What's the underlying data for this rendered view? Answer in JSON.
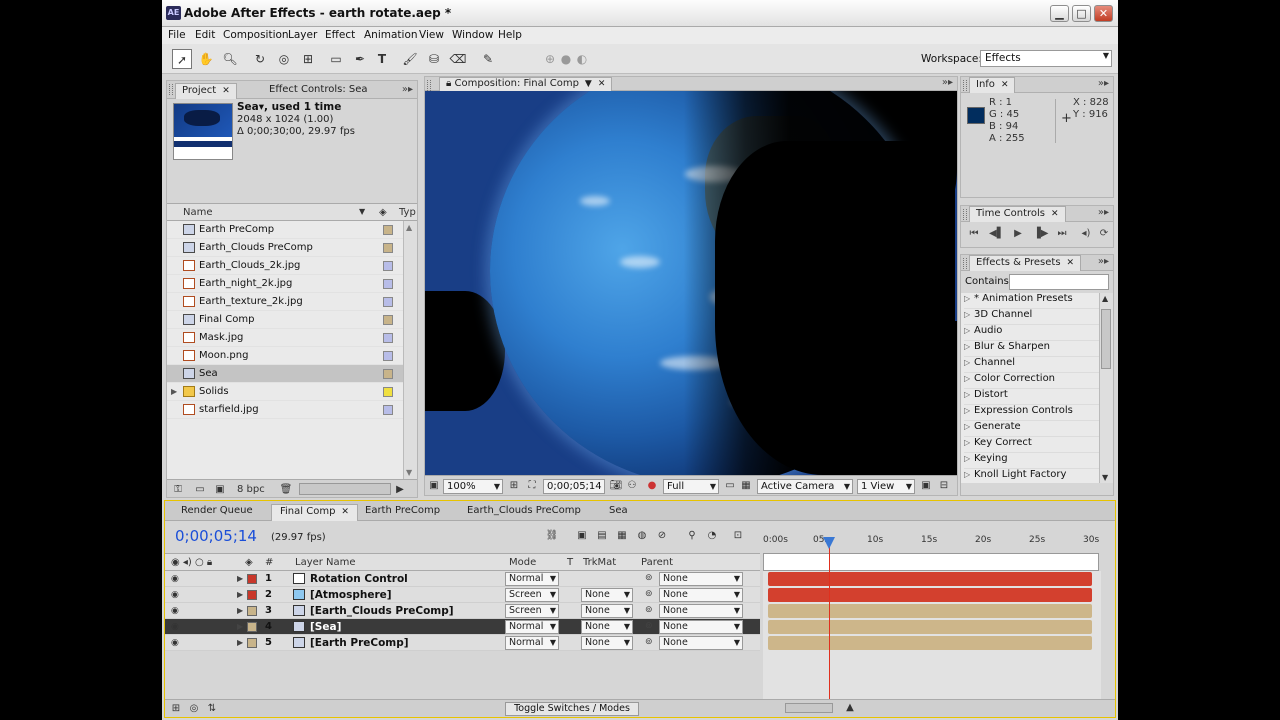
{
  "window": {
    "app_badge": "AE",
    "title": "Adobe After Effects - earth rotate.aep *",
    "minimize": "▁",
    "maximize": "□",
    "close": "✕"
  },
  "menu": [
    "File",
    "Edit",
    "Composition",
    "Layer",
    "Effect",
    "Animation",
    "View",
    "Window",
    "Help"
  ],
  "toolbar": {
    "workspace_label": "Workspace:",
    "workspace_value": "Effects"
  },
  "project": {
    "tab_project": "Project",
    "tab_effect_controls": "Effect Controls: Sea",
    "item_name": "Sea▾, used 1 time",
    "item_dims": "2048 x 1024 (1.00)",
    "item_duration": "Δ 0;00;30;00, 29.97 fps",
    "col_name": "Name",
    "col_type": "Typ",
    "items": [
      {
        "name": "Earth PreComp",
        "kind": "comp",
        "label": "#c8b48a"
      },
      {
        "name": "Earth_Clouds PreComp",
        "kind": "comp",
        "label": "#c8b48a"
      },
      {
        "name": "Earth_Clouds_2k.jpg",
        "kind": "img",
        "label": "#b8bde8"
      },
      {
        "name": "Earth_night_2k.jpg",
        "kind": "img",
        "label": "#b8bde8"
      },
      {
        "name": "Earth_texture_2k.jpg",
        "kind": "img",
        "label": "#b8bde8"
      },
      {
        "name": "Final Comp",
        "kind": "comp",
        "label": "#c8b48a"
      },
      {
        "name": "Mask.jpg",
        "kind": "img",
        "label": "#b8bde8"
      },
      {
        "name": "Moon.png",
        "kind": "img",
        "label": "#b8bde8"
      },
      {
        "name": "Sea",
        "kind": "comp",
        "label": "#c8b48a"
      },
      {
        "name": "Solids",
        "kind": "folder",
        "label": "#f0e040"
      },
      {
        "name": "starfield.jpg",
        "kind": "img",
        "label": "#b8bde8"
      }
    ],
    "bpc": "8 bpc"
  },
  "composition": {
    "tab": "Composition: Final Comp",
    "zoom": "100%",
    "timecode": "0;00;05;14",
    "resolution": "Full",
    "camera": "Active Camera",
    "view": "1 View"
  },
  "info": {
    "tab": "Info",
    "r": "R : 1",
    "g": "G : 45",
    "b": "B : 94",
    "a": "A : 255",
    "x": "X : 828",
    "y": "Y : 916",
    "swatch_color": "#012d5e"
  },
  "time_controls": {
    "tab": "Time Controls"
  },
  "effects": {
    "tab": "Effects & Presets",
    "contains_label": "Contains:",
    "items": [
      "* Animation Presets",
      "3D Channel",
      "Audio",
      "Blur & Sharpen",
      "Channel",
      "Color Correction",
      "Distort",
      "Expression Controls",
      "Generate",
      "Key Correct",
      "Keying",
      "Knoll Light Factory"
    ]
  },
  "timeline": {
    "tabs": [
      "Render Queue",
      "Final Comp",
      "Earth PreComp",
      "Earth_Clouds PreComp",
      "Sea"
    ],
    "timecode": "0;00;05;14",
    "fps": "(29.97 fps)",
    "col_layer_name": "Layer Name",
    "col_num": "#",
    "col_mode": "Mode",
    "col_t": "T",
    "col_trkmat": "TrkMat",
    "col_parent": "Parent",
    "ruler": [
      "0:00s",
      "05s",
      "10s",
      "15s",
      "20s",
      "25s",
      "30s"
    ],
    "layers": [
      {
        "num": "1",
        "name": "Rotation Control",
        "mode": "Normal",
        "trkmat": "",
        "parent": "None",
        "color": "#c8372a",
        "bar": "#d3402e",
        "icon": "#ffffff"
      },
      {
        "num": "2",
        "name": "[Atmosphere]",
        "mode": "Screen",
        "trkmat": "None",
        "parent": "None",
        "color": "#c8372a",
        "bar": "#d3402e",
        "icon": "#8ec8f0"
      },
      {
        "num": "3",
        "name": "[Earth_Clouds PreComp]",
        "mode": "Screen",
        "trkmat": "None",
        "parent": "None",
        "color": "#c8b48a",
        "bar": "#cdb68a",
        "icon": "#cdd5e8"
      },
      {
        "num": "4",
        "name": "[Sea]",
        "mode": "Normal",
        "trkmat": "None",
        "parent": "None",
        "color": "#c8b48a",
        "bar": "#cdb68a",
        "icon": "#cdd5e8"
      },
      {
        "num": "5",
        "name": "[Earth PreComp]",
        "mode": "Normal",
        "trkmat": "None",
        "parent": "None",
        "color": "#c8b48a",
        "bar": "#cdb68a",
        "icon": "#cdd5e8"
      }
    ],
    "toggle_label": "Toggle Switches / Modes"
  }
}
